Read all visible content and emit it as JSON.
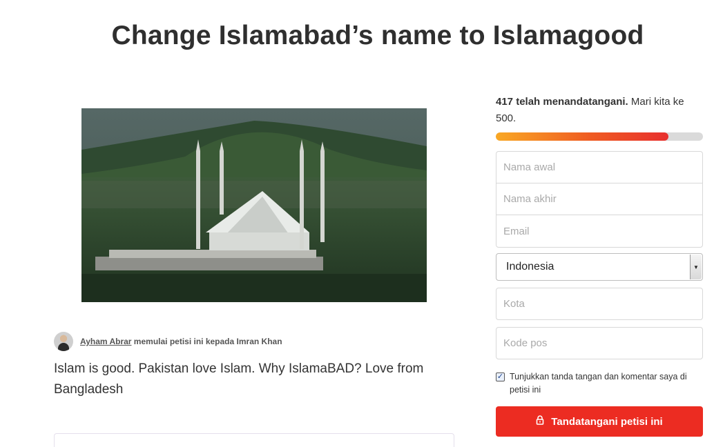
{
  "petition": {
    "title": "Change Islamabad’s name to Islamagood",
    "starter_name": "Ayham Abrar",
    "starter_suffix": " memulai petisi ini kepada Imran Khan",
    "description": "Islam is good. Pakistan love Islam. Why IslamaBAD? Love from Bangladesh"
  },
  "progress": {
    "signed_text": "417 telah menandatangani.",
    "goal_text": " Mari kita ke 500.",
    "signed": 417,
    "goal": 500
  },
  "form": {
    "first_name_placeholder": "Nama awal",
    "last_name_placeholder": "Nama akhir",
    "email_placeholder": "Email",
    "country_value": "Indonesia",
    "city_placeholder": "Kota",
    "postal_placeholder": "Kode pos",
    "consent_label": "Tunjukkan tanda tangan dan komentar saya di petisi ini",
    "consent_checked": true,
    "sign_button_label": "Tandatangani petisi ini",
    "sign_button_icon": "lock-icon"
  },
  "colors": {
    "button_red": "#ec2c22",
    "progress_start": "#f9a825",
    "progress_end": "#e8302e"
  }
}
